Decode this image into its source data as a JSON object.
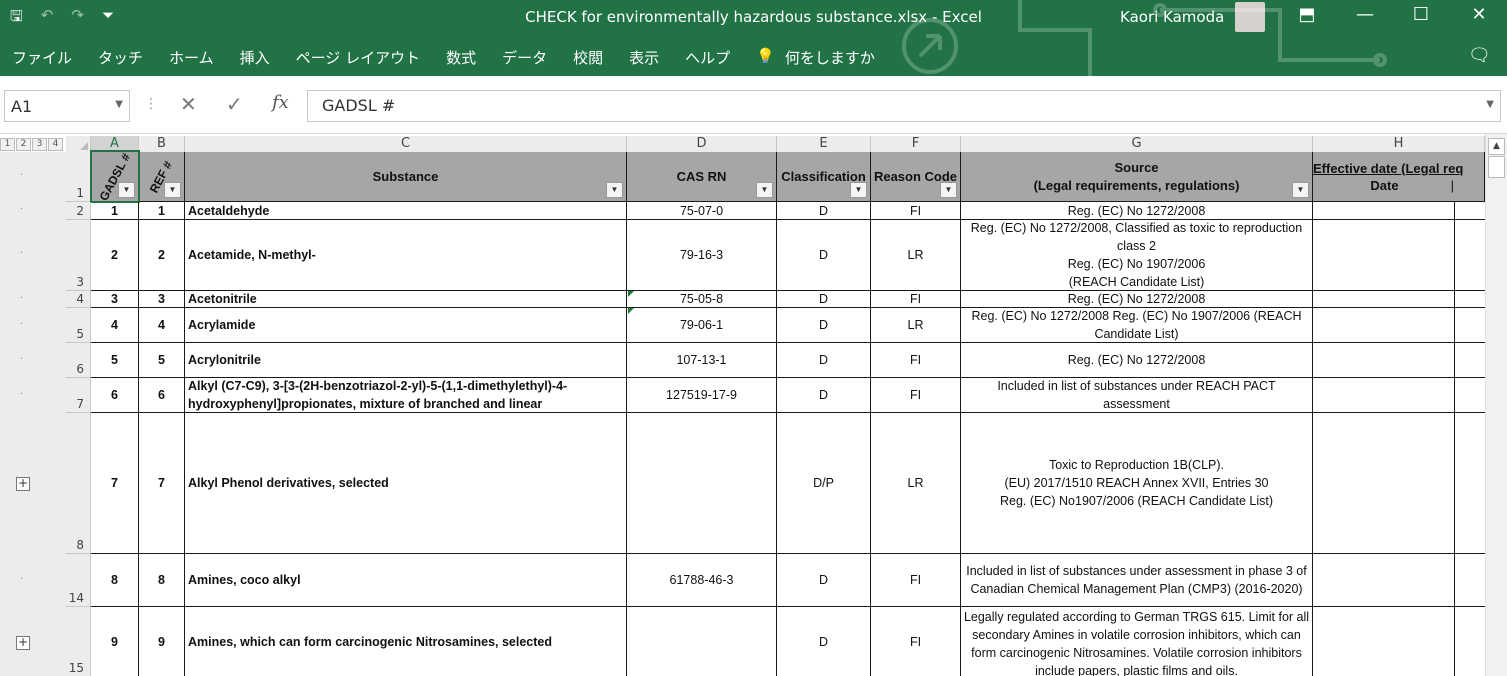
{
  "app": {
    "title": "CHECK for environmentally hazardous substance.xlsx  -  Excel",
    "user": "Kaori Kamoda",
    "qat": {
      "save": "🖫",
      "undo": "↶",
      "redo": "↷",
      "customize": "⏷"
    },
    "window": {
      "ribbon_display": "⬒",
      "minimize": "—",
      "maximize": "☐",
      "close": "✕"
    }
  },
  "ribbon": {
    "tabs": [
      "ファイル",
      "タッチ",
      "ホーム",
      "挿入",
      "ページ レイアウト",
      "数式",
      "データ",
      "校閲",
      "表示",
      "ヘルプ"
    ],
    "search_icon": "💡",
    "search": "何をしますか",
    "comments_icon": "🗨"
  },
  "formula_bar": {
    "name_box": "A1",
    "cancel": "✕",
    "enter": "✓",
    "fx": "fx",
    "content": "GADSL #"
  },
  "outline_levels": [
    "1",
    "2",
    "3",
    "4"
  ],
  "columns": [
    "A",
    "B",
    "C",
    "D",
    "E",
    "F",
    "G",
    "H"
  ],
  "header_row": {
    "row_num": "1",
    "a": "GADSL #",
    "b": "REF #",
    "c": "Substance",
    "d": "CAS RN",
    "e": "Classification",
    "f": "Reason Code",
    "g": "Source\n(Legal requirements, regulations)",
    "h": "Effective date (Legal req",
    "h_sub": "Date"
  },
  "rows": [
    {
      "num": "2",
      "a": "1",
      "b": "1",
      "c": "Acetaldehyde",
      "d": "75-07-0",
      "e": "D",
      "f": "FI",
      "g": "Reg. (EC) No 1272/2008"
    },
    {
      "num": "3",
      "a": "2",
      "b": "2",
      "c": "Acetamide, N-methyl-",
      "d": "79-16-3",
      "e": "D",
      "f": "LR",
      "g": "Reg. (EC) No 1272/2008, Classified as toxic to reproduction class 2\nReg. (EC) No 1907/2006\n(REACH Candidate List)"
    },
    {
      "num": "4",
      "a": "3",
      "b": "3",
      "c": "Acetonitrile",
      "d": "75-05-8",
      "e": "D",
      "f": "FI",
      "g": "Reg. (EC) No 1272/2008"
    },
    {
      "num": "5",
      "a": "4",
      "b": "4",
      "c": "Acrylamide",
      "d": "79-06-1",
      "e": "D",
      "f": "LR",
      "g": "Reg. (EC) No 1272/2008 Reg. (EC) No 1907/2006 (REACH Candidate List)"
    },
    {
      "num": "6",
      "a": "5",
      "b": "5",
      "c": "Acrylonitrile",
      "d": "107-13-1",
      "e": "D",
      "f": "FI",
      "g": "Reg. (EC) No 1272/2008"
    },
    {
      "num": "7",
      "a": "6",
      "b": "6",
      "c": "Alkyl (C7-C9), 3-[3-(2H-benzotriazol-2-yl)-5-(1,1-dimethylethyl)-4-hydroxyphenyl]propionates, mixture of branched and linear",
      "d": "127519-17-9",
      "e": "D",
      "f": "FI",
      "g": "Included in list of substances under REACH PACT assessment"
    },
    {
      "num": "8",
      "a": "7",
      "b": "7",
      "c": "Alkyl Phenol derivatives, selected",
      "d": "",
      "e": "D/P",
      "f": "LR",
      "g": "Toxic to Reproduction 1B(CLP).\n(EU) 2017/1510 REACH  Annex XVII, Entries  30\nReg. (EC) No1907/2006 (REACH Candidate List)"
    },
    {
      "num": "14",
      "a": "8",
      "b": "8",
      "c": "Amines, coco alkyl",
      "d": "61788-46-3",
      "e": "D",
      "f": "FI",
      "g": "Included in list of substances under assessment in phase 3 of Canadian Chemical Management Plan (CMP3) (2016-2020)"
    },
    {
      "num": "15",
      "a": "9",
      "b": "9",
      "c": "Amines, which can form carcinogenic Nitrosamines, selected",
      "d": "",
      "e": "D",
      "f": "FI",
      "g": "Legally regulated according to German TRGS 615. Limit for all secondary Amines in volatile corrosion inhibitors, which can form carcinogenic Nitrosamines. Volatile corrosion inhibitors include papers, plastic films and oils."
    }
  ],
  "outline": {
    "plus": "+",
    "dot": "·"
  },
  "filter_icon": "▼",
  "h_header_mark": "|",
  "scrollbar": {
    "up": "▲"
  },
  "colors": {
    "excel_green": "#217346",
    "header_fill": "#a6a6a6"
  }
}
